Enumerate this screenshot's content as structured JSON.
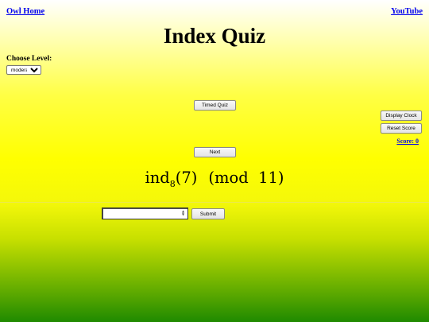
{
  "nav": {
    "home_label": "Owl Home",
    "youtube_label": "YouTube"
  },
  "title": "Index Quiz",
  "level": {
    "label": "Choose Level:",
    "selected": "moderate"
  },
  "buttons": {
    "timed": "Timed Quiz",
    "clock": "Display Clock",
    "reset": "Reset Score",
    "next": "Next",
    "submit": "Submit"
  },
  "score": {
    "label": "Score:",
    "value": "0"
  },
  "question": {
    "func": "ind",
    "base": "8",
    "arg": "(7)",
    "mod_text": "(mod",
    "modulus": "11",
    "close": ")"
  },
  "answer": {
    "value": ""
  },
  "colors": {
    "link": "#0000ee",
    "bg_top": "#ffffff",
    "bg_mid": "#ffff00",
    "bg_bottom": "#1f8a00"
  }
}
